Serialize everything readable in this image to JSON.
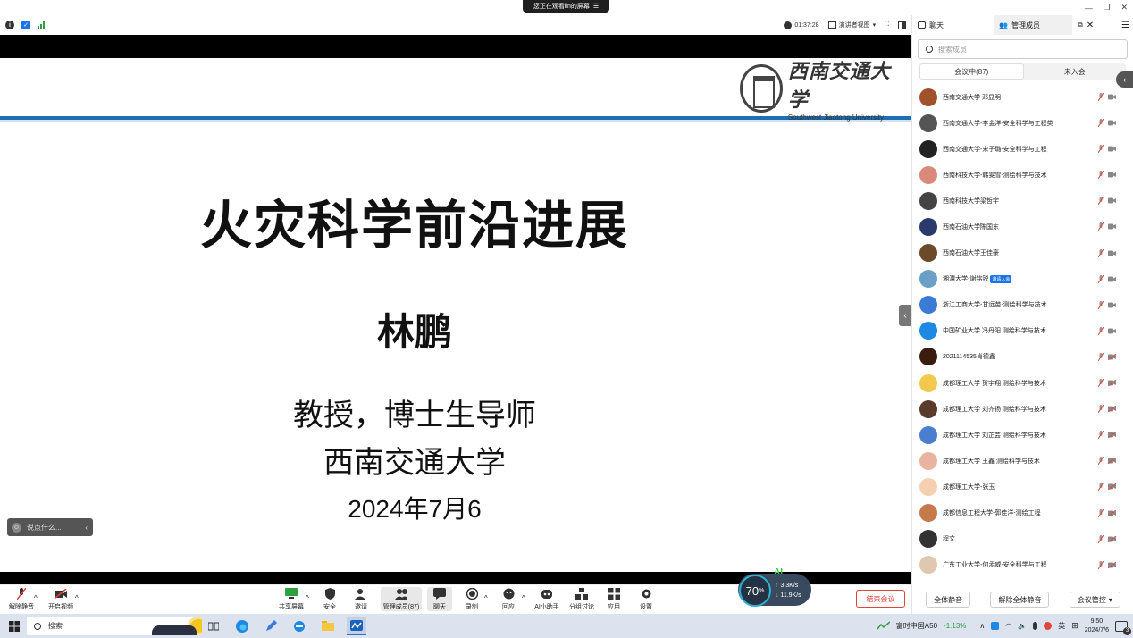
{
  "share_banner": {
    "text": "您正在观看lin的屏幕"
  },
  "topbar": {
    "timer": "01:37:28",
    "view_mode": "演讲者视图"
  },
  "slide": {
    "logo_cn": "西南交通大学",
    "logo_en": "Southwest Jiaotong University",
    "title": "火灾科学前沿进展",
    "name": "林鹏",
    "role": "教授，博士生导师",
    "org": "西南交通大学",
    "date": "2024年7月6"
  },
  "chat_hint": {
    "placeholder": "说点什么..."
  },
  "panel": {
    "tab_chat": "聊天",
    "tab_members": "管理成员",
    "search_placeholder": "搜索成员",
    "seg_in": "会议中(87)",
    "seg_out": "未入会",
    "members": [
      {
        "name": "西南交通大学 邓显明",
        "color": "#a0522d",
        "badge": ""
      },
      {
        "name": "西南交通大学-李金洋-安全科学与工程类",
        "color": "#555555",
        "badge": ""
      },
      {
        "name": "西南交通大学-宋子璐-安全科学与工程",
        "color": "#222222",
        "badge": ""
      },
      {
        "name": "西南科技大学-韩雯雪-测绘科学与技术",
        "color": "#d98a7a",
        "badge": ""
      },
      {
        "name": "西南科技大学梁哲宇",
        "color": "#444444",
        "badge": ""
      },
      {
        "name": "西南石油大学陈国东",
        "color": "#2b3a6a",
        "badge": ""
      },
      {
        "name": "西南石油大学王佳豪",
        "color": "#6b4a2a",
        "badge": ""
      },
      {
        "name": "湘潭大学-谢铭锐",
        "color": "#6aa0c8",
        "badge": "邀请入会"
      },
      {
        "name": "浙江工商大学-甘远苗-测绘科学与技术",
        "color": "#3a7bd5",
        "badge": ""
      },
      {
        "name": "中国矿业大学 冯丹阳 测绘科学与技术",
        "color": "#1e88e5",
        "badge": ""
      },
      {
        "name": "2021114535肖德鑫",
        "color": "#3a1d0f",
        "badge": ""
      },
      {
        "name": "成都理工大学 贺宇翔 测绘科学与技术",
        "color": "#f2c94c",
        "badge": ""
      },
      {
        "name": "成都理工大学 刘齐扬 测绘科学与技术",
        "color": "#5a3a2a",
        "badge": ""
      },
      {
        "name": "成都理工大学 刘芷芸 测绘科学与技术",
        "color": "#4a7fd0",
        "badge": ""
      },
      {
        "name": "成都理工大学 王鑫 测绘科学与技术",
        "color": "#e8b4a0",
        "badge": ""
      },
      {
        "name": "成都理工大学-张玉",
        "color": "#f5d0b0",
        "badge": ""
      },
      {
        "name": "成都信息工程大学-郭佳洋-测绘工程",
        "color": "#c47a4a",
        "badge": ""
      },
      {
        "name": "程文",
        "color": "#333333",
        "badge": ""
      },
      {
        "name": "广东工业大学-何孟威-安全科学与工程",
        "color": "#e0c8b0",
        "badge": ""
      }
    ],
    "btn_mute_all": "全体静音",
    "btn_unmute_all": "解除全体静音",
    "btn_control": "会议管控"
  },
  "toolbar": {
    "unmute": "解除静音",
    "video": "开启视频",
    "share": "共享屏幕",
    "security": "安全",
    "invite": "邀请",
    "members": "管理成员(87)",
    "chat": "聊天",
    "record": "录制",
    "react": "回应",
    "ai": "AI小助手",
    "breakout": "分组讨论",
    "apps": "应用",
    "settings": "设置",
    "end": "结束会议"
  },
  "speed": {
    "percent": "70",
    "up": "3.3K/s",
    "down": "11.9K/s",
    "ai_label": "AI"
  },
  "taskbar": {
    "search": "搜索",
    "stock_name": "富时中国A50",
    "stock_change": "-1.13%",
    "ime": "英",
    "time": "9:50",
    "date": "2024/7/6",
    "notif": "3"
  }
}
